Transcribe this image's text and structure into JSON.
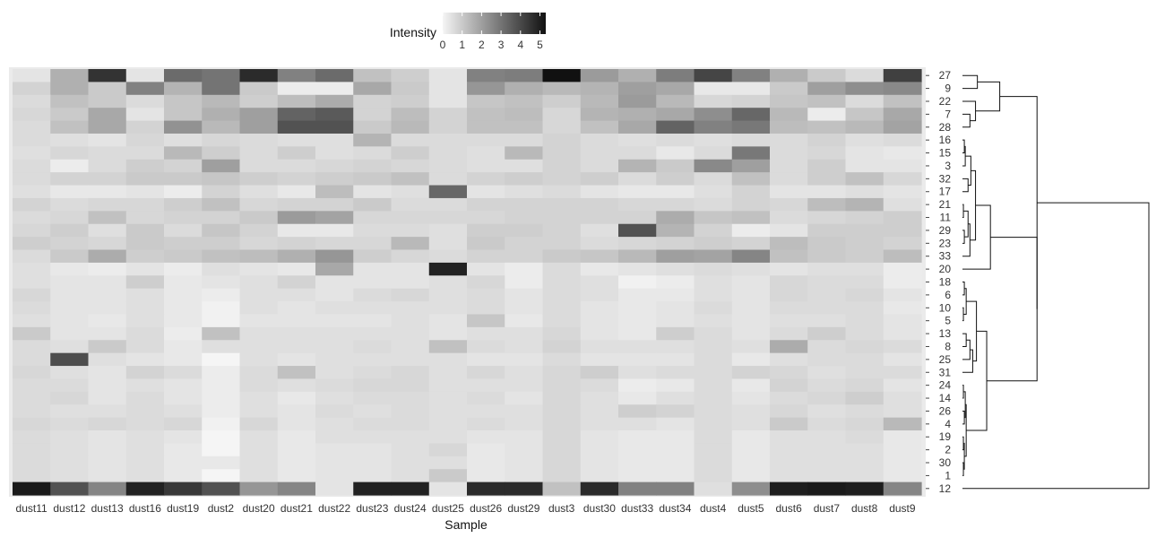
{
  "chart_data": {
    "type": "heatmap",
    "xlabel": "Sample",
    "legend": {
      "title": "Intensity",
      "ticks": [
        0,
        1,
        2,
        3,
        4,
        5
      ],
      "range": [
        0,
        5.3
      ],
      "colors": [
        "#f5f5f5",
        "#111111"
      ],
      "position": "top"
    },
    "x": [
      "dust11",
      "dust12",
      "dust13",
      "dust16",
      "dust19",
      "dust2",
      "dust20",
      "dust21",
      "dust22",
      "dust23",
      "dust24",
      "dust25",
      "dust26",
      "dust29",
      "dust3",
      "dust30",
      "dust33",
      "dust34",
      "dust4",
      "dust5",
      "dust6",
      "dust7",
      "dust8",
      "dust9"
    ],
    "y": [
      "27",
      "9",
      "22",
      "7",
      "28",
      "16",
      "15",
      "3",
      "32",
      "17",
      "21",
      "11",
      "29",
      "23",
      "33",
      "20",
      "18",
      "6",
      "10",
      "5",
      "13",
      "8",
      "25",
      "31",
      "24",
      "14",
      "26",
      "4",
      "19",
      "2",
      "30",
      "1",
      "12"
    ],
    "values": [
      [
        0.4,
        1.6,
        4.5,
        0.4,
        3.2,
        3.0,
        4.7,
        2.7,
        3.2,
        1.2,
        0.9,
        0.4,
        2.7,
        2.8,
        5.3,
        2.1,
        1.6,
        2.8,
        4.1,
        2.7,
        1.6,
        1.0,
        0.6,
        4.2
      ],
      [
        0.8,
        1.6,
        1.0,
        2.7,
        1.5,
        3.0,
        1.0,
        0.2,
        0.2,
        1.8,
        1.0,
        0.4,
        2.2,
        1.6,
        1.4,
        1.5,
        2.0,
        1.8,
        0.3,
        0.3,
        1.0,
        2.0,
        2.4,
        2.5
      ],
      [
        0.6,
        1.2,
        1.0,
        0.6,
        1.1,
        1.4,
        0.9,
        1.3,
        1.7,
        0.8,
        0.9,
        0.4,
        1.1,
        1.2,
        0.9,
        1.4,
        2.1,
        1.4,
        0.7,
        0.8,
        1.1,
        1.2,
        0.6,
        1.2
      ],
      [
        0.7,
        1.0,
        1.8,
        0.4,
        1.1,
        1.6,
        2.0,
        3.4,
        3.6,
        0.8,
        1.3,
        0.8,
        1.2,
        1.3,
        0.7,
        1.5,
        1.6,
        1.8,
        2.4,
        3.3,
        1.4,
        0.2,
        1.1,
        1.8
      ],
      [
        0.6,
        1.2,
        1.8,
        0.8,
        2.3,
        1.4,
        2.0,
        3.8,
        3.8,
        1.0,
        1.4,
        0.8,
        1.2,
        1.2,
        0.7,
        1.2,
        1.8,
        3.4,
        2.7,
        2.9,
        1.3,
        1.2,
        1.4,
        1.9
      ],
      [
        0.6,
        0.5,
        0.4,
        0.7,
        0.5,
        0.7,
        0.6,
        0.5,
        0.5,
        1.5,
        0.6,
        0.6,
        0.6,
        0.6,
        0.8,
        0.6,
        0.5,
        0.6,
        0.5,
        0.6,
        0.6,
        0.8,
        0.5,
        0.6
      ],
      [
        0.5,
        0.7,
        0.6,
        0.6,
        1.4,
        0.9,
        0.6,
        0.9,
        0.5,
        0.6,
        0.9,
        0.6,
        0.5,
        1.4,
        0.8,
        0.6,
        0.6,
        0.3,
        0.6,
        2.9,
        0.6,
        0.7,
        0.4,
        0.3
      ],
      [
        0.6,
        0.2,
        0.6,
        0.9,
        0.8,
        2.0,
        0.6,
        0.6,
        0.7,
        0.8,
        0.7,
        0.6,
        0.5,
        0.5,
        0.8,
        0.6,
        1.5,
        1.0,
        2.5,
        2.0,
        0.6,
        0.9,
        0.4,
        0.4
      ],
      [
        0.6,
        0.8,
        0.8,
        1.0,
        1.0,
        1.1,
        0.9,
        0.8,
        0.9,
        1.0,
        1.2,
        0.6,
        0.8,
        0.9,
        0.8,
        0.9,
        0.6,
        0.9,
        0.6,
        1.2,
        0.6,
        0.9,
        1.2,
        0.7
      ],
      [
        0.5,
        0.3,
        0.3,
        0.4,
        0.2,
        0.8,
        0.5,
        0.3,
        1.3,
        0.4,
        0.5,
        3.3,
        0.4,
        0.5,
        0.6,
        0.4,
        0.3,
        0.3,
        0.5,
        0.8,
        0.4,
        0.4,
        0.5,
        0.4
      ],
      [
        0.8,
        0.6,
        0.7,
        0.7,
        0.9,
        1.2,
        0.7,
        0.8,
        0.8,
        1.0,
        0.6,
        0.6,
        0.8,
        0.8,
        0.8,
        0.8,
        0.7,
        0.7,
        0.6,
        0.8,
        0.7,
        1.3,
        1.5,
        0.5
      ],
      [
        0.6,
        0.7,
        1.2,
        0.7,
        0.8,
        0.8,
        1.0,
        2.1,
        1.9,
        0.7,
        0.7,
        0.7,
        0.7,
        0.8,
        0.8,
        0.8,
        0.8,
        1.7,
        1.1,
        1.2,
        0.6,
        0.7,
        0.8,
        0.9
      ],
      [
        0.7,
        0.9,
        0.5,
        1.0,
        0.6,
        1.1,
        0.8,
        0.3,
        0.3,
        0.6,
        0.6,
        0.5,
        0.9,
        0.9,
        0.8,
        0.5,
        3.8,
        1.5,
        0.8,
        0.2,
        0.4,
        0.9,
        0.9,
        0.9
      ],
      [
        0.9,
        0.8,
        0.7,
        1.0,
        0.9,
        0.9,
        0.7,
        0.8,
        0.7,
        0.7,
        1.4,
        0.5,
        1.0,
        0.8,
        0.8,
        0.6,
        0.7,
        0.8,
        0.9,
        0.8,
        1.3,
        1.0,
        0.9,
        0.8
      ],
      [
        0.6,
        1.0,
        1.7,
        0.9,
        1.0,
        1.2,
        1.3,
        1.6,
        2.2,
        0.9,
        0.7,
        0.6,
        0.8,
        0.8,
        1.0,
        1.1,
        1.4,
        2.0,
        1.9,
        2.6,
        1.2,
        1.0,
        0.9,
        1.3
      ],
      [
        0.5,
        0.3,
        0.2,
        0.4,
        0.2,
        0.5,
        0.4,
        0.3,
        1.8,
        0.4,
        0.4,
        4.9,
        0.4,
        0.2,
        0.6,
        0.3,
        0.4,
        0.5,
        0.6,
        0.5,
        0.4,
        0.5,
        0.5,
        0.2
      ],
      [
        0.5,
        0.4,
        0.4,
        0.9,
        0.3,
        0.4,
        0.5,
        0.8,
        0.4,
        0.4,
        0.4,
        0.5,
        0.7,
        0.2,
        0.6,
        0.5,
        0.1,
        0.2,
        0.5,
        0.4,
        0.7,
        0.6,
        0.6,
        0.2
      ],
      [
        0.7,
        0.4,
        0.4,
        0.5,
        0.3,
        0.2,
        0.5,
        0.5,
        0.4,
        0.6,
        0.7,
        0.5,
        0.6,
        0.4,
        0.6,
        0.5,
        0.3,
        0.3,
        0.5,
        0.4,
        0.7,
        0.6,
        0.7,
        0.4
      ],
      [
        0.6,
        0.4,
        0.4,
        0.5,
        0.3,
        0.1,
        0.5,
        0.4,
        0.5,
        0.5,
        0.5,
        0.5,
        0.6,
        0.4,
        0.6,
        0.4,
        0.3,
        0.4,
        0.6,
        0.4,
        0.6,
        0.6,
        0.6,
        0.3
      ],
      [
        0.5,
        0.4,
        0.3,
        0.5,
        0.3,
        0.1,
        0.4,
        0.4,
        0.4,
        0.4,
        0.5,
        0.4,
        1.1,
        0.3,
        0.6,
        0.4,
        0.3,
        0.4,
        0.5,
        0.4,
        0.5,
        0.5,
        0.6,
        0.4
      ],
      [
        1.0,
        0.4,
        0.4,
        0.6,
        0.2,
        1.2,
        0.5,
        0.5,
        0.5,
        0.5,
        0.5,
        0.4,
        0.5,
        0.5,
        0.7,
        0.4,
        0.3,
        0.9,
        0.6,
        0.4,
        0.6,
        0.9,
        0.6,
        0.4
      ],
      [
        0.6,
        0.5,
        1.0,
        0.6,
        0.3,
        0.5,
        0.5,
        0.5,
        0.5,
        0.6,
        0.5,
        1.2,
        0.6,
        0.5,
        0.8,
        0.5,
        0.5,
        0.5,
        0.6,
        0.5,
        1.7,
        0.6,
        0.7,
        0.6
      ],
      [
        0.6,
        3.9,
        0.5,
        0.4,
        0.3,
        0.0,
        0.5,
        0.4,
        0.5,
        0.5,
        0.5,
        0.5,
        0.4,
        0.4,
        0.6,
        0.4,
        0.4,
        0.4,
        0.6,
        0.3,
        0.5,
        0.6,
        0.6,
        0.4
      ],
      [
        0.7,
        0.5,
        0.4,
        0.8,
        0.6,
        0.2,
        0.6,
        1.2,
        0.5,
        0.6,
        0.7,
        0.5,
        0.7,
        0.5,
        0.7,
        0.9,
        0.5,
        0.6,
        0.6,
        0.8,
        0.7,
        0.5,
        0.6,
        0.6
      ],
      [
        0.6,
        0.6,
        0.4,
        0.5,
        0.4,
        0.2,
        0.6,
        0.5,
        0.6,
        0.7,
        0.7,
        0.5,
        0.5,
        0.5,
        0.7,
        0.6,
        0.2,
        0.3,
        0.6,
        0.3,
        0.8,
        0.6,
        0.7,
        0.4
      ],
      [
        0.6,
        0.7,
        0.4,
        0.6,
        0.4,
        0.2,
        0.5,
        0.3,
        0.5,
        0.6,
        0.6,
        0.5,
        0.6,
        0.4,
        0.7,
        0.5,
        0.3,
        0.5,
        0.6,
        0.4,
        0.6,
        0.7,
        0.9,
        0.5
      ],
      [
        0.6,
        0.5,
        0.5,
        0.6,
        0.5,
        0.2,
        0.5,
        0.4,
        0.6,
        0.5,
        0.6,
        0.5,
        0.5,
        0.5,
        0.7,
        0.5,
        0.9,
        0.8,
        0.6,
        0.5,
        0.7,
        0.5,
        0.6,
        0.5
      ],
      [
        0.7,
        0.6,
        0.7,
        0.6,
        0.7,
        0.1,
        0.7,
        0.4,
        0.5,
        0.6,
        0.6,
        0.5,
        0.6,
        0.5,
        0.7,
        0.5,
        0.5,
        0.4,
        0.6,
        0.5,
        1.0,
        0.6,
        0.7,
        1.4
      ],
      [
        0.6,
        0.5,
        0.4,
        0.5,
        0.4,
        0.0,
        0.5,
        0.3,
        0.5,
        0.5,
        0.5,
        0.5,
        0.4,
        0.4,
        0.7,
        0.4,
        0.3,
        0.3,
        0.6,
        0.3,
        0.5,
        0.5,
        0.6,
        0.3
      ],
      [
        0.6,
        0.5,
        0.4,
        0.5,
        0.3,
        0.0,
        0.5,
        0.3,
        0.4,
        0.4,
        0.5,
        0.7,
        0.3,
        0.4,
        0.7,
        0.4,
        0.3,
        0.3,
        0.6,
        0.3,
        0.5,
        0.5,
        0.5,
        0.3
      ],
      [
        0.6,
        0.5,
        0.4,
        0.5,
        0.3,
        0.3,
        0.5,
        0.3,
        0.4,
        0.4,
        0.5,
        0.5,
        0.3,
        0.4,
        0.7,
        0.4,
        0.3,
        0.3,
        0.6,
        0.3,
        0.5,
        0.5,
        0.5,
        0.3
      ],
      [
        0.6,
        0.5,
        0.4,
        0.5,
        0.3,
        0.0,
        0.5,
        0.3,
        0.4,
        0.4,
        0.5,
        1.0,
        0.3,
        0.4,
        0.7,
        0.4,
        0.3,
        0.3,
        0.6,
        0.3,
        0.5,
        0.5,
        0.5,
        0.3
      ],
      [
        5.1,
        3.8,
        2.6,
        4.9,
        4.4,
        3.8,
        2.2,
        2.6,
        0.4,
        4.9,
        4.9,
        0.4,
        4.7,
        4.7,
        1.2,
        4.7,
        2.7,
        2.7,
        0.5,
        2.4,
        5.0,
        5.1,
        5.0,
        2.6
      ]
    ]
  }
}
